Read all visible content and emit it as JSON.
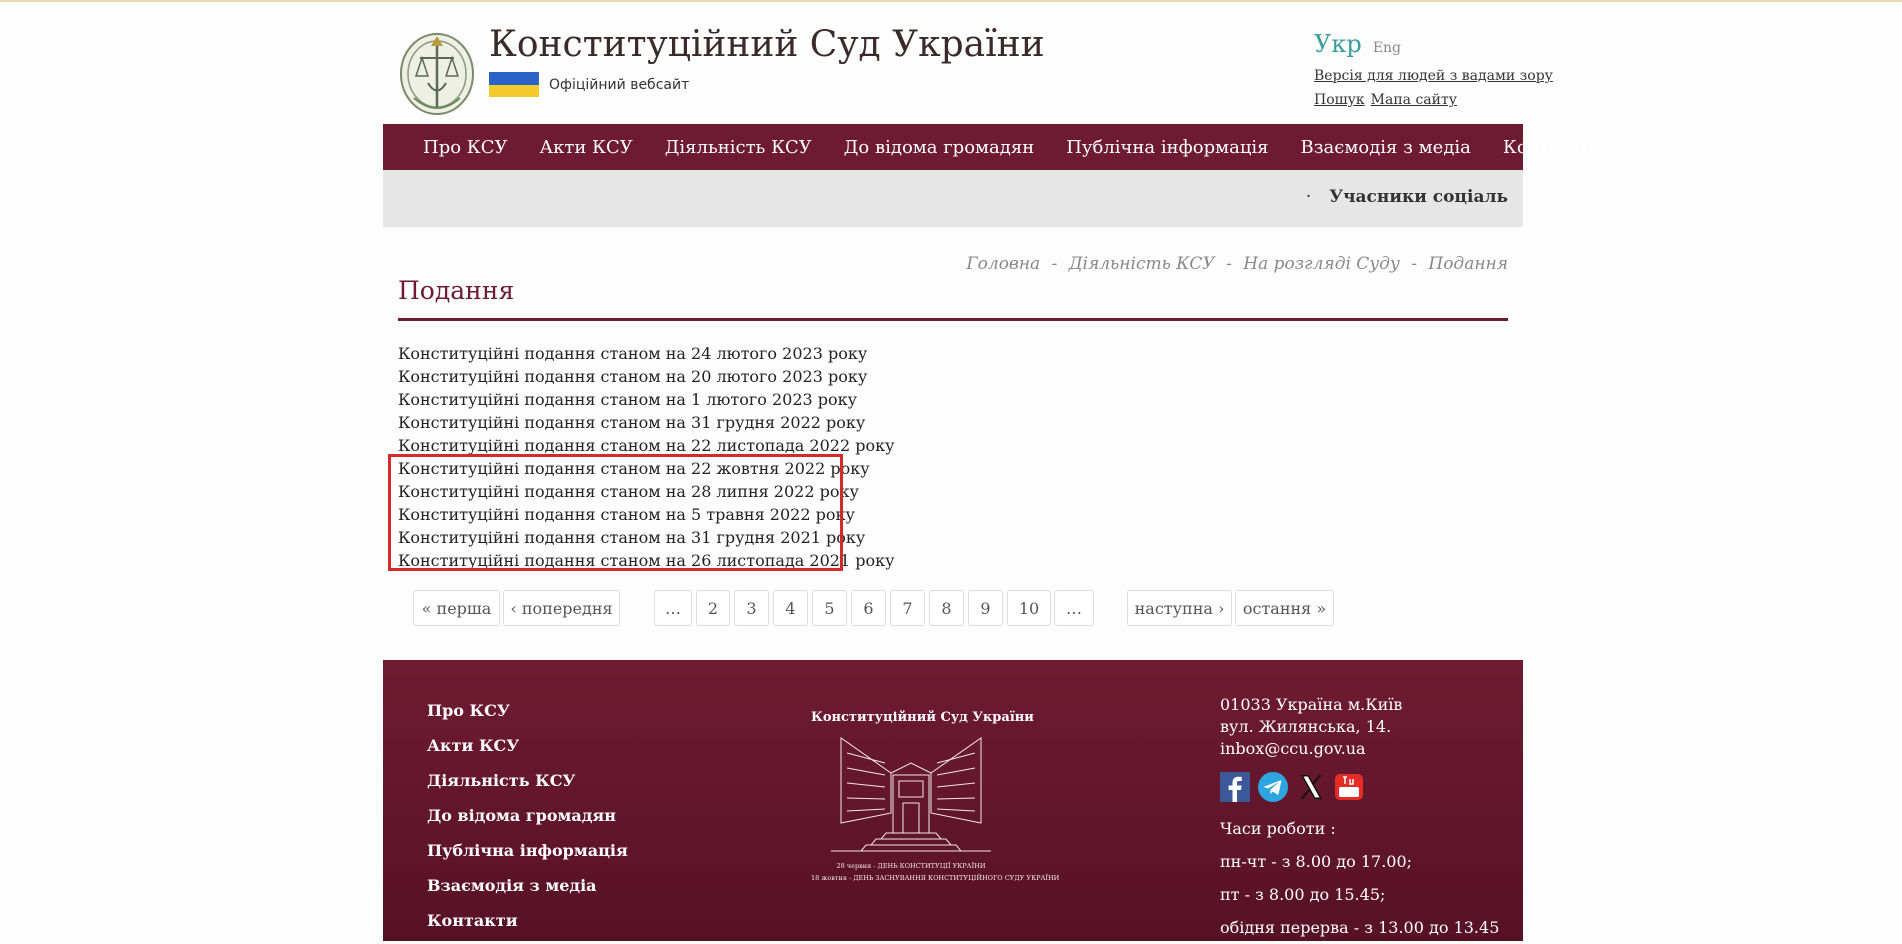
{
  "header": {
    "title": "Конституційний Суд України",
    "subtitle": "Офіційний вебсайт",
    "lang_active": "Укр",
    "lang_other": "Eng",
    "accessibility_link": "Версія для людей з вадами зору",
    "search_link": "Пошук",
    "sitemap_link": "Мапа сайту"
  },
  "nav": {
    "items": [
      "Про КСУ",
      "Акти КСУ",
      "Діяльність КСУ",
      "До відома громадян",
      "Публічна інформація",
      "Взаємодія з медіа",
      "Контакти"
    ]
  },
  "ticker": {
    "bullet": "·",
    "text": "Учасники соціаль"
  },
  "breadcrumb": {
    "separator": "-",
    "items": [
      "Головна",
      "Діяльність КСУ",
      "На розгляді Суду",
      "Подання"
    ]
  },
  "page": {
    "title": "Подання",
    "items": [
      "Конституційні подання станом на 24 лютого 2023 року",
      "Конституційні подання станом на 20 лютого 2023 року",
      "Конституційні подання станом на 1 лютого 2023 року",
      "Конституційні подання станом на 31 грудня 2022 року",
      "Конституційні подання станом на 22 листопада 2022 року",
      "Конституційні подання станом на 22 жовтня 2022 року",
      "Конституційні подання станом на 28 липня 2022 року",
      "Конституційні подання станом на 5 травня 2022 року",
      "Конституційні подання станом на 31 грудня 2021 року",
      "Конституційні подання станом на 26 листопада 2021 року"
    ]
  },
  "pagination": {
    "first": "« перша",
    "prev": "‹ попередня",
    "ellipsis": "…",
    "pages": [
      "2",
      "3",
      "4",
      "5",
      "6",
      "7",
      "8",
      "9",
      "10"
    ],
    "next": "наступна ›",
    "last": "остання »"
  },
  "footer": {
    "nav": [
      "Про КСУ",
      "Акти КСУ",
      "Діяльність КСУ",
      "До відома громадян",
      "Публічна інформація",
      "Взаємодія з медіа",
      "Контакти"
    ],
    "center_title": "Конституційний Суд України",
    "caption_1": "28 червня - ДЕНЬ КОНСТИТУЦІЇ УКРАЇНИ",
    "caption_2": "18 жовтня - ДЕНЬ ЗАСНУВАННЯ КОНСТИТУЦІЙНОГО СУДУ УКРАЇНИ",
    "address_1": "01033 Україна м.Київ",
    "address_2": "вул. Жилянська, 14.",
    "email": "inbox@ccu.gov.ua",
    "hours_label": "Часи роботи :",
    "hours_1": "пн-чт - з 8.00 до 17.00;",
    "hours_2": "пт - з 8.00 до 15.45;",
    "hours_3": "обідня перерва - з 13.00 до 13.45"
  },
  "icons": {
    "logo": "court-emblem-icon",
    "facebook": "facebook-icon",
    "telegram": "telegram-icon",
    "x": "x-icon",
    "youtube": "youtube-icon"
  },
  "colors": {
    "brand": "#6d1a32",
    "accent": "#3a9e98",
    "flag_blue": "#2a62c8",
    "flag_yellow": "#f3cb2a",
    "highlight": "#d42a2a"
  }
}
